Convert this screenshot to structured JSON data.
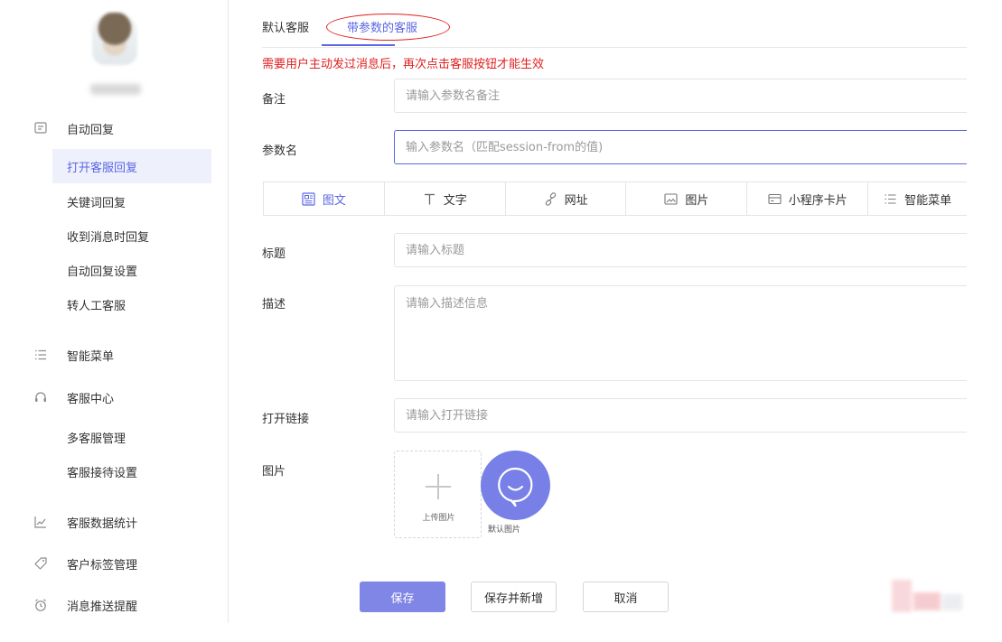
{
  "sidebar": {
    "groups": [
      {
        "label": "自动回复",
        "icon": "chat-square-icon"
      },
      {
        "label": "智能菜单",
        "icon": "menu-list-icon"
      },
      {
        "label": "客服中心",
        "icon": "headset-icon"
      },
      {
        "label": "客服数据统计",
        "icon": "line-chart-icon"
      },
      {
        "label": "客户标签管理",
        "icon": "tag-icon"
      },
      {
        "label": "消息推送提醒",
        "icon": "alarm-clock-icon"
      }
    ],
    "auto_reply_items": [
      "打开客服回复",
      "关键词回复",
      "收到消息时回复",
      "自动回复设置",
      "转人工客服"
    ],
    "service_items": [
      "多客服管理",
      "客服接待设置"
    ],
    "active_item": "打开客服回复"
  },
  "tabs": {
    "default": "默认客服",
    "param": "带参数的客服",
    "active": "带参数的客服"
  },
  "notice": "需要用户主动发过消息后，再次点击客服按钮才能生效",
  "form": {
    "remark": {
      "label": "备注",
      "placeholder": "请输入参数名备注"
    },
    "param_name": {
      "label": "参数名",
      "placeholder": "输入参数名（匹配session-from的值)"
    },
    "types": [
      {
        "label": "图文",
        "icon": "image-text-icon"
      },
      {
        "label": "文字",
        "icon": "text-t-icon"
      },
      {
        "label": "网址",
        "icon": "link-icon"
      },
      {
        "label": "图片",
        "icon": "picture-icon"
      },
      {
        "label": "小程序卡片",
        "icon": "card-icon"
      },
      {
        "label": "智能菜单",
        "icon": "menu-list-icon"
      }
    ],
    "active_type": "图文",
    "title": {
      "label": "标题",
      "placeholder": "请输入标题"
    },
    "description": {
      "label": "描述",
      "placeholder": "请输入描述信息"
    },
    "link": {
      "label": "打开链接",
      "placeholder": "请输入打开链接"
    },
    "image": {
      "label": "图片",
      "upload_label": "上传图片",
      "default_label": "默认图片"
    }
  },
  "actions": {
    "save": "保存",
    "save_new": "保存并新增",
    "cancel": "取消"
  },
  "colors": {
    "accent": "#5b67e3",
    "notice": "#e02020",
    "save_button": "#7f86e6",
    "annotation": "#e0201f"
  }
}
